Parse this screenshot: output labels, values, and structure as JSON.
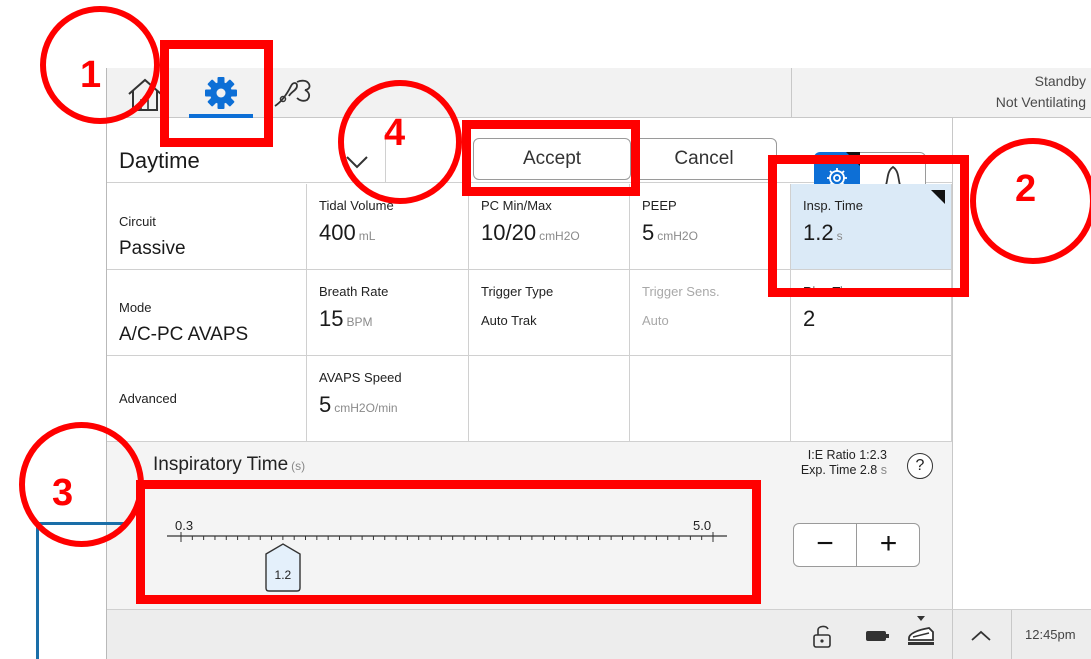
{
  "topbar": {
    "tabs": [
      {
        "name": "home",
        "icon": "home-icon"
      },
      {
        "name": "settings",
        "icon": "gear-icon",
        "active": true
      },
      {
        "name": "tools",
        "icon": "wrench-icon"
      }
    ],
    "status_line1": "Standby",
    "status_line2": "Not Ventilating",
    "accent_color": "#0d6fd6"
  },
  "preset": {
    "name": "Daytime",
    "accept_label": "Accept",
    "cancel_label": "Cancel"
  },
  "grid": {
    "circuit": {
      "label": "Circuit",
      "value": "Passive"
    },
    "mode": {
      "label": "Mode",
      "value": "A/C-PC AVAPS"
    },
    "advanced": {
      "label": "Advanced"
    },
    "tidal_volume": {
      "label": "Tidal Volume",
      "value": "400",
      "unit": "mL"
    },
    "pc_minmax": {
      "label": "PC Min/Max",
      "value": "10/20",
      "unit": "cmH2O"
    },
    "peep": {
      "label": "PEEP",
      "value": "5",
      "unit": "cmH2O"
    },
    "insp_time": {
      "label": "Insp. Time",
      "value": "1.2",
      "unit": "s"
    },
    "breath_rate": {
      "label": "Breath Rate",
      "value": "15",
      "unit": "BPM"
    },
    "trigger_type": {
      "label": "Trigger Type",
      "value": "Auto Trak"
    },
    "trigger_sens": {
      "label": "Trigger Sens.",
      "value": "Auto"
    },
    "rise_time": {
      "label": "Rise Time",
      "value": "2"
    },
    "avaps_speed": {
      "label": "AVAPS Speed",
      "value": "5",
      "unit": "cmH2O/min"
    }
  },
  "slider": {
    "title": "Inspiratory Time",
    "unit": "(s)",
    "ie_ratio": "I:E Ratio 1:2.3",
    "exp_time_label": "Exp. Time 2.8",
    "exp_time_unit": "s",
    "help": "?",
    "min_label": "0.3",
    "max_label": "5.0",
    "min": 0.3,
    "max": 5.0,
    "value": 1.2,
    "value_label": "1.2",
    "minus": "−",
    "plus": "+"
  },
  "bottombar": {
    "time": "12:45pm"
  },
  "annotations": [
    {
      "number": "1"
    },
    {
      "number": "2"
    },
    {
      "number": "3"
    },
    {
      "number": "4"
    }
  ]
}
